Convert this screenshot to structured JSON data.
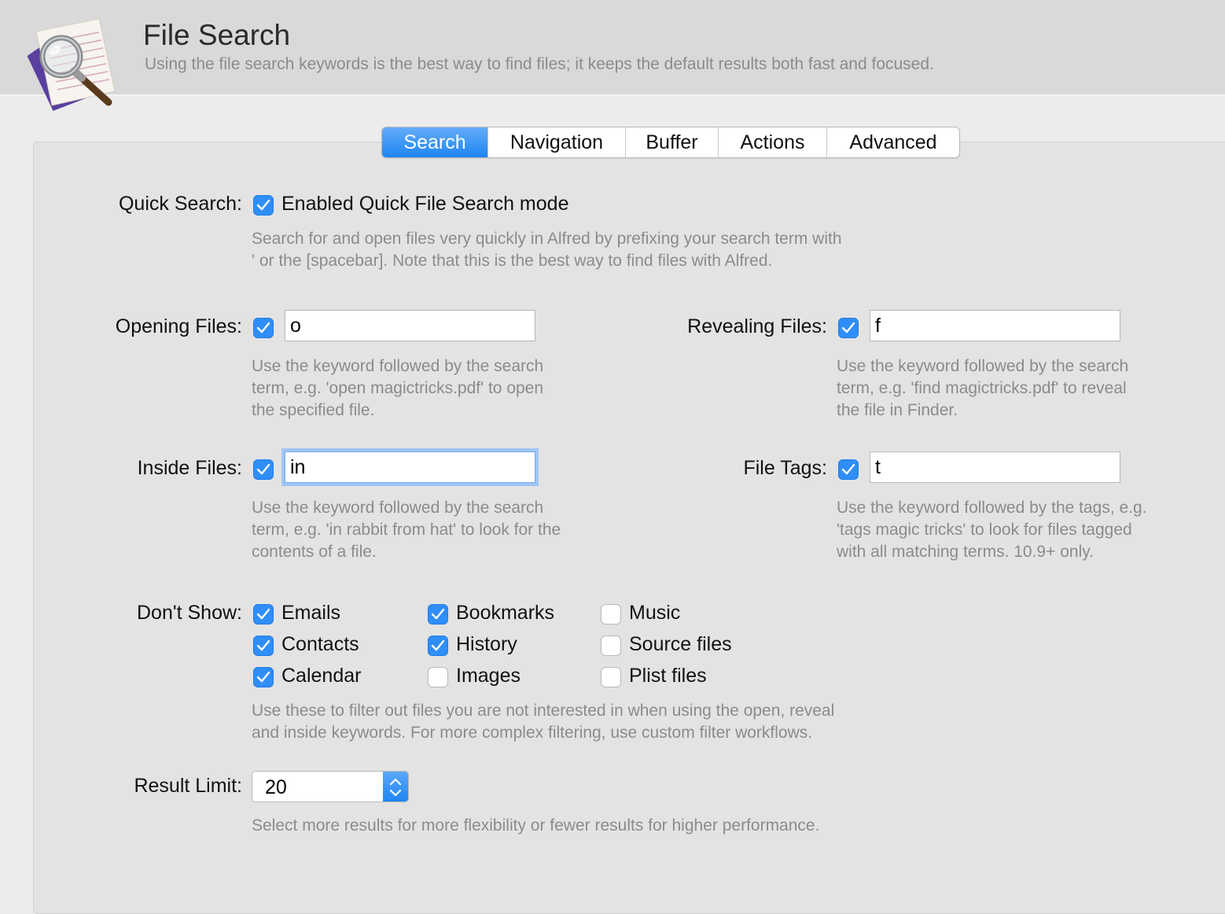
{
  "header": {
    "title": "File Search",
    "subtitle": "Using the file search keywords is the best way to find files; it keeps the default results both fast and focused."
  },
  "tabs": [
    {
      "label": "Search",
      "active": true
    },
    {
      "label": "Navigation",
      "active": false
    },
    {
      "label": "Buffer",
      "active": false
    },
    {
      "label": "Actions",
      "active": false
    },
    {
      "label": "Advanced",
      "active": false
    }
  ],
  "quick_search": {
    "label": "Quick Search:",
    "checkbox_label": "Enabled Quick File Search mode",
    "checked": true,
    "desc": [
      "Search for and open files very quickly in Alfred by prefixing your search term with",
      "' or the [spacebar]. Note that this is the best way to find files with Alfred."
    ]
  },
  "opening_files": {
    "label": "Opening Files:",
    "checked": true,
    "value": "o",
    "desc": [
      "Use the keyword followed by the search",
      "term, e.g. 'open magictricks.pdf' to open",
      "the specified file."
    ]
  },
  "revealing_files": {
    "label": "Revealing Files:",
    "checked": true,
    "value": "f",
    "desc": [
      "Use the keyword followed by the search",
      "term, e.g. 'find magictricks.pdf' to reveal",
      "the file in Finder."
    ]
  },
  "inside_files": {
    "label": "Inside Files:",
    "checked": true,
    "value": "in",
    "desc": [
      "Use the keyword followed by the search",
      "term, e.g. 'in rabbit from hat' to look for the",
      "contents of a file."
    ]
  },
  "file_tags": {
    "label": "File Tags:",
    "checked": true,
    "value": "t",
    "desc": [
      "Use the keyword followed by the tags, e.g.",
      "'tags magic tricks' to look for files tagged",
      "with all matching terms. 10.9+ only."
    ]
  },
  "dont_show": {
    "label": "Don't Show:",
    "items": [
      {
        "label": "Emails",
        "checked": true
      },
      {
        "label": "Contacts",
        "checked": true
      },
      {
        "label": "Calendar",
        "checked": true
      },
      {
        "label": "Bookmarks",
        "checked": true
      },
      {
        "label": "History",
        "checked": true
      },
      {
        "label": "Images",
        "checked": false
      },
      {
        "label": "Music",
        "checked": false
      },
      {
        "label": "Source files",
        "checked": false
      },
      {
        "label": "Plist files",
        "checked": false
      }
    ],
    "desc": [
      "Use these to filter out files you are not interested in when using the open, reveal",
      "and inside keywords. For more complex filtering, use custom filter workflows."
    ]
  },
  "result_limit": {
    "label": "Result Limit:",
    "value": "20",
    "desc": [
      "Select more results for more flexibility or fewer results for higher performance."
    ]
  },
  "colors": {
    "accent": "#2f8ef8",
    "header_bg": "#d9d9d9",
    "panel_bg": "#e3e3e3",
    "muted_text": "#8b8b8b"
  }
}
